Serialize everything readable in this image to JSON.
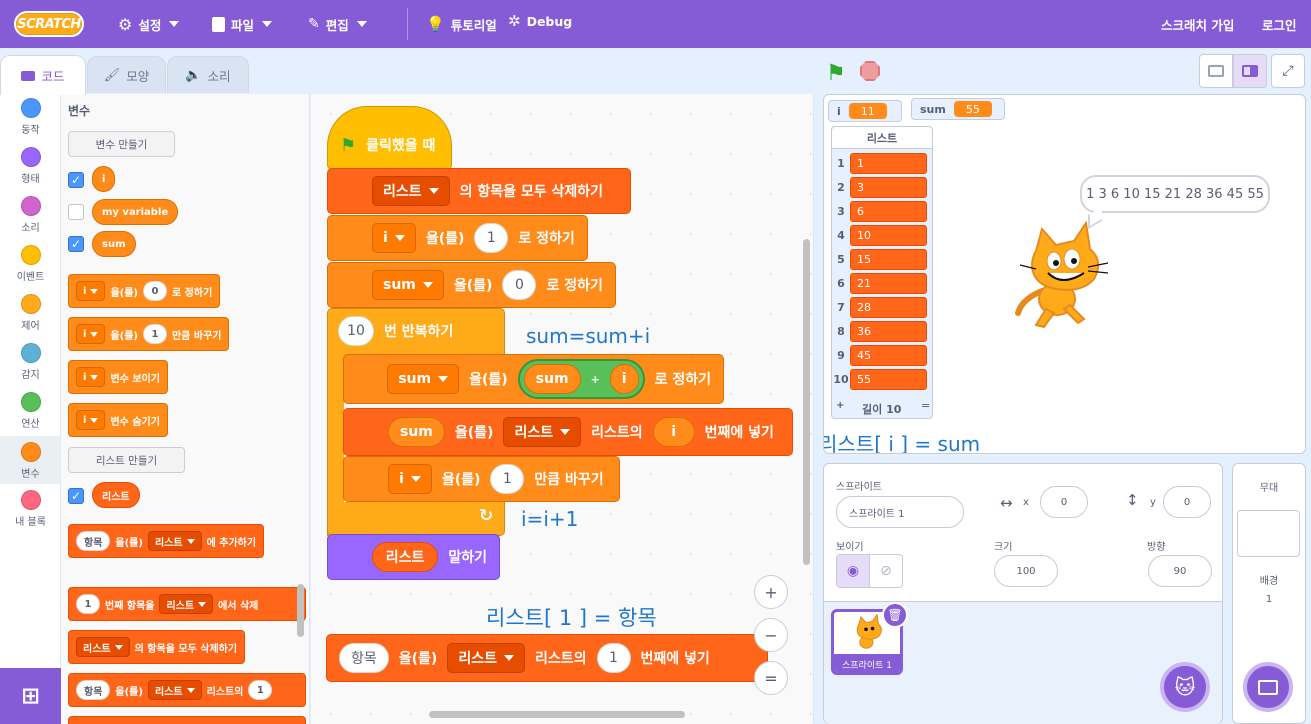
{
  "menu": {
    "logo": "SCRATCH",
    "settings": "설정",
    "file": "파일",
    "edit": "편집",
    "tutorials": "튜토리얼",
    "debug": "Debug",
    "join": "스크래치 가입",
    "signin": "로그인"
  },
  "tabs": {
    "code": "코드",
    "costumes": "모양",
    "sounds": "소리"
  },
  "categories": [
    {
      "label": "동작",
      "color": "#4c97ff"
    },
    {
      "label": "형태",
      "color": "#9966ff"
    },
    {
      "label": "소리",
      "color": "#cf63cf"
    },
    {
      "label": "이벤트",
      "color": "#ffbf00"
    },
    {
      "label": "제어",
      "color": "#ffab19"
    },
    {
      "label": "감지",
      "color": "#5cb1d6"
    },
    {
      "label": "연산",
      "color": "#59c059"
    },
    {
      "label": "변수",
      "color": "#ff8c1a"
    },
    {
      "label": "내 블록",
      "color": "#ff6680"
    }
  ],
  "palette": {
    "heading": "변수",
    "make_var": "변수 만들기",
    "vars": [
      "i",
      "my variable",
      "sum"
    ],
    "set_block": {
      "var": "i",
      "text1": "을(를)",
      "val": "0",
      "text2": "로 정하기"
    },
    "change_block": {
      "var": "i",
      "text1": "을(를)",
      "val": "1",
      "text2": "만큼 바꾸기"
    },
    "show_block": {
      "var": "i",
      "text": "변수 보이기"
    },
    "hide_block": {
      "var": "i",
      "text": "변수 숨기기"
    },
    "make_list": "리스트 만들기",
    "list_name": "리스트",
    "add_block": {
      "item": "항목",
      "text1": "을(를)",
      "list": "리스트",
      "text2": "에 추가하기"
    },
    "delete_block": {
      "val": "1",
      "text1": "번째 항목을",
      "list": "리스트",
      "text2": "에서 삭제"
    },
    "deleteall_block": {
      "list": "리스트",
      "text": "의 항목을 모두 삭제하기"
    },
    "insert_block": {
      "item": "항목",
      "text1": "을(를)",
      "list": "리스트",
      "text2": "리스트의",
      "val": "1"
    }
  },
  "script": {
    "hat": "클릭했을 때",
    "clear": {
      "list": "리스트",
      "text": "의 항목을 모두 삭제하기"
    },
    "set_i": {
      "var": "i",
      "text1": "을(를)",
      "val": "1",
      "text2": "로 정하기"
    },
    "set_sum": {
      "var": "sum",
      "text1": "을(를)",
      "val": "0",
      "text2": "로 정하기"
    },
    "repeat": {
      "val": "10",
      "text": "번 반복하기"
    },
    "set_sum2": {
      "var": "sum",
      "text1": "을(를)",
      "left": "sum",
      "op": "+",
      "right": "i",
      "text2": "로 정하기"
    },
    "insert": {
      "var": "sum",
      "text1": "을(를)",
      "list": "리스트",
      "text2": "리스트의",
      "idx": "i",
      "text3": "번째에 넣기"
    },
    "change_i": {
      "var": "i",
      "text1": "을(를)",
      "val": "1",
      "text2": "만큼 바꾸기"
    },
    "say": {
      "list": "리스트",
      "text": "말하기"
    },
    "loose": {
      "item": "항목",
      "text1": "을(를)",
      "list": "리스트",
      "text2": "리스트의",
      "val": "1",
      "text3": "번째에 넣기"
    }
  },
  "annotations": {
    "sum": "sum=sum+i",
    "inc": "i=i+1",
    "first": "리스트[ 1 ] = 항목",
    "listsum": "리스트[ i ] = sum"
  },
  "zoom": {
    "in": "+",
    "out": "−",
    "reset": "="
  },
  "stage": {
    "monitor_i": {
      "name": "i",
      "value": "11"
    },
    "monitor_sum": {
      "name": "sum",
      "value": "55"
    },
    "list_title": "리스트",
    "list_items": [
      "1",
      "3",
      "6",
      "10",
      "15",
      "21",
      "28",
      "36",
      "45",
      "55"
    ],
    "list_indices": [
      "1",
      "2",
      "3",
      "4",
      "5",
      "6",
      "7",
      "8",
      "9",
      "10"
    ],
    "list_add": "+",
    "list_length": "길이 10",
    "list_resize": "=",
    "speech": "1 3 6 10 15 21 28 36 45 55"
  },
  "sprite_info": {
    "sprite_label": "스프라이트",
    "sprite_name": "스프라이트 1",
    "x_label": "x",
    "x": "0",
    "y_label": "y",
    "y": "0",
    "show_label": "보이기",
    "size_label": "크기",
    "size": "100",
    "direction_label": "방향",
    "direction": "90",
    "thumb_name": "스프라이트 1"
  },
  "stage_pane": {
    "title": "무대",
    "backdrops_label": "배경",
    "backdrops": "1"
  },
  "colors": {
    "menu": "#855cd6",
    "variables": "#ff8c1a",
    "lists": "#ff661a",
    "events": "#ffbf00",
    "looks": "#9966ff",
    "operators": "#59c059",
    "annotation": "#1f77c9"
  }
}
